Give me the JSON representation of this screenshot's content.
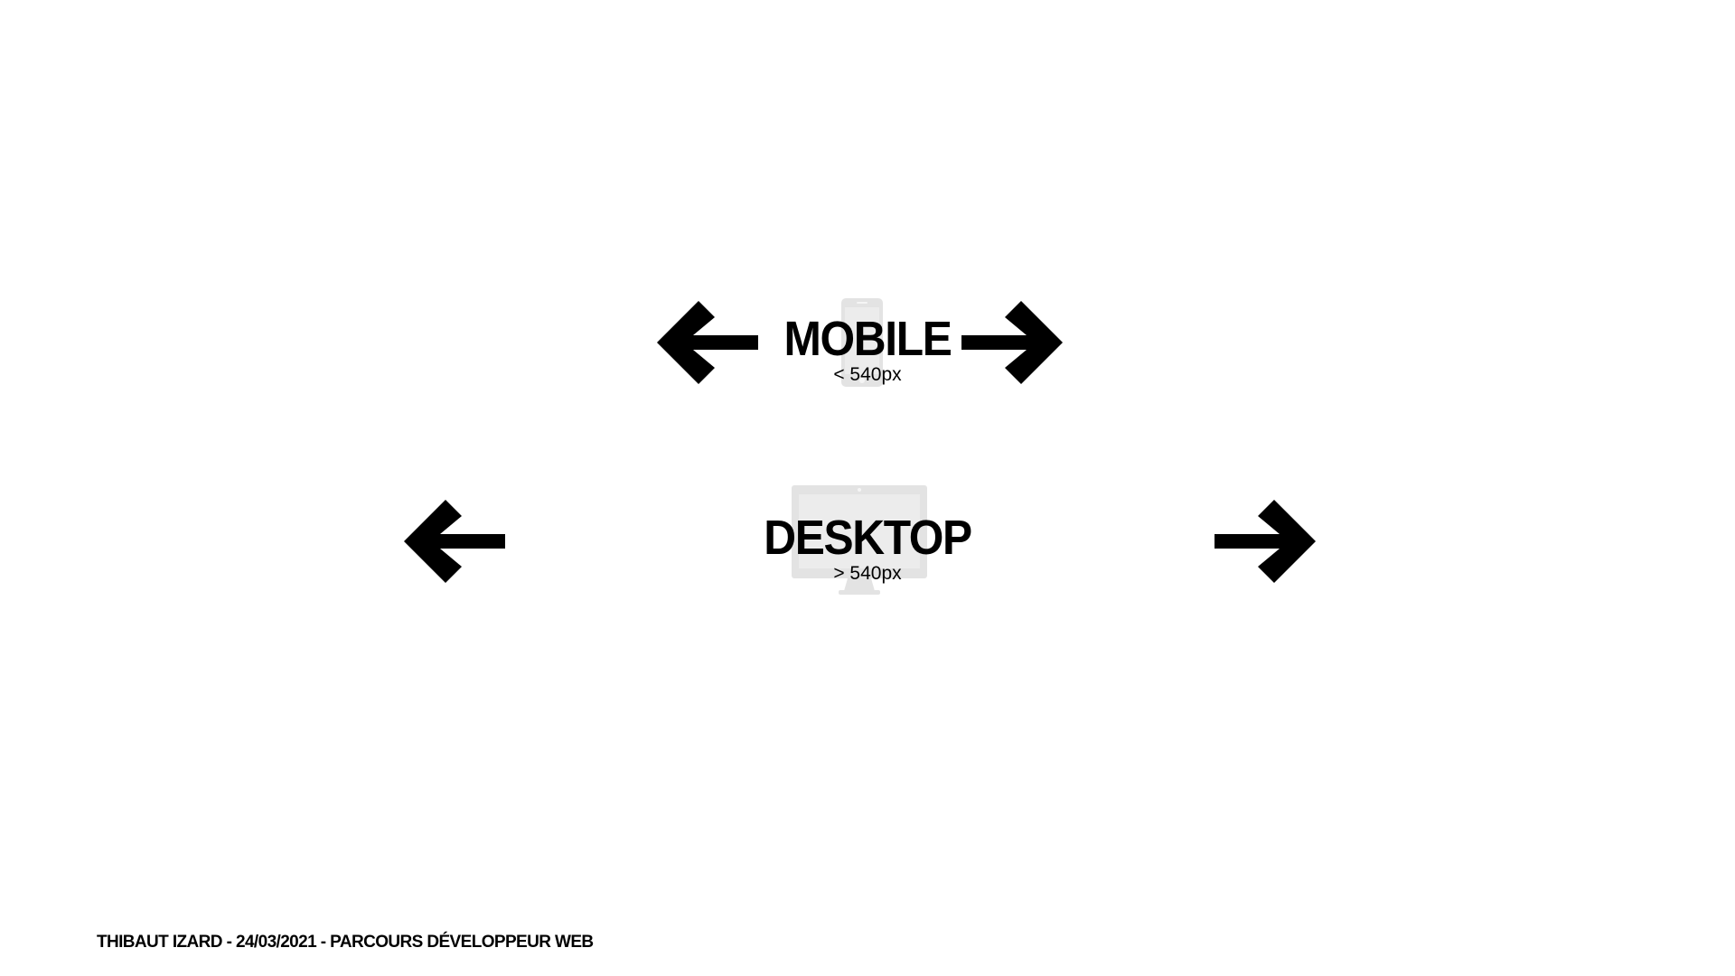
{
  "mobile": {
    "title": "MOBILE",
    "width": "< 540px",
    "icon": "smartphone-icon"
  },
  "desktop": {
    "title": "DESKTOP",
    "width": "> 540px",
    "icon": "monitor-icon"
  },
  "arrows": {
    "left_icon": "arrow-left-icon",
    "right_icon": "arrow-right-icon",
    "color": "#000000"
  },
  "device_icon_color": "#e2e2e2",
  "footer": {
    "text": "THIBAUT IZARD - 24/03/2021 - PARCOURS DÉVELOPPEUR WEB"
  }
}
